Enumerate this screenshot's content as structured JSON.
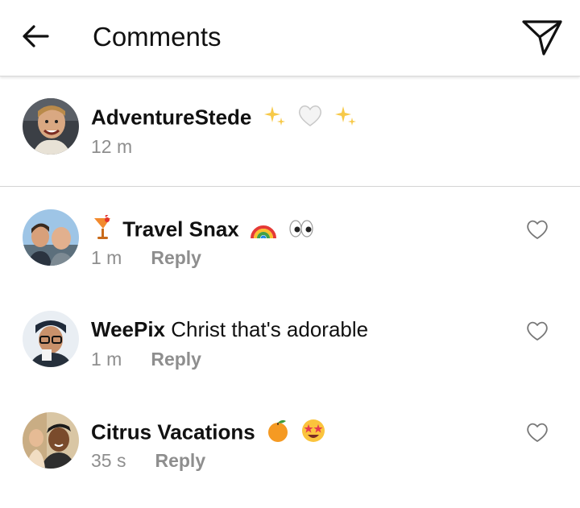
{
  "header": {
    "title": "Comments",
    "back_icon": "arrow-left-icon",
    "send_icon": "paper-plane-icon"
  },
  "caption": {
    "username": "AdventureStede",
    "emojis": [
      "sparkles",
      "white-heart",
      "sparkles"
    ],
    "time": "12 m"
  },
  "comments": [
    {
      "prefix_emoji": "tropical-drink",
      "username": "Travel Snax",
      "text": "",
      "emojis": [
        "rainbow",
        "eyes"
      ],
      "time": "1 m",
      "reply_label": "Reply"
    },
    {
      "prefix_emoji": "",
      "username": "WeePix",
      "text": "Christ that's adorable",
      "emojis": [],
      "time": "1 m",
      "reply_label": "Reply"
    },
    {
      "prefix_emoji": "",
      "username": "Citrus Vacations",
      "text": "",
      "emojis": [
        "orange",
        "star-struck"
      ],
      "time": "35 s",
      "reply_label": "Reply"
    }
  ],
  "colors": {
    "muted_text": "#8e8e8e",
    "divider": "#d4d4d4"
  }
}
